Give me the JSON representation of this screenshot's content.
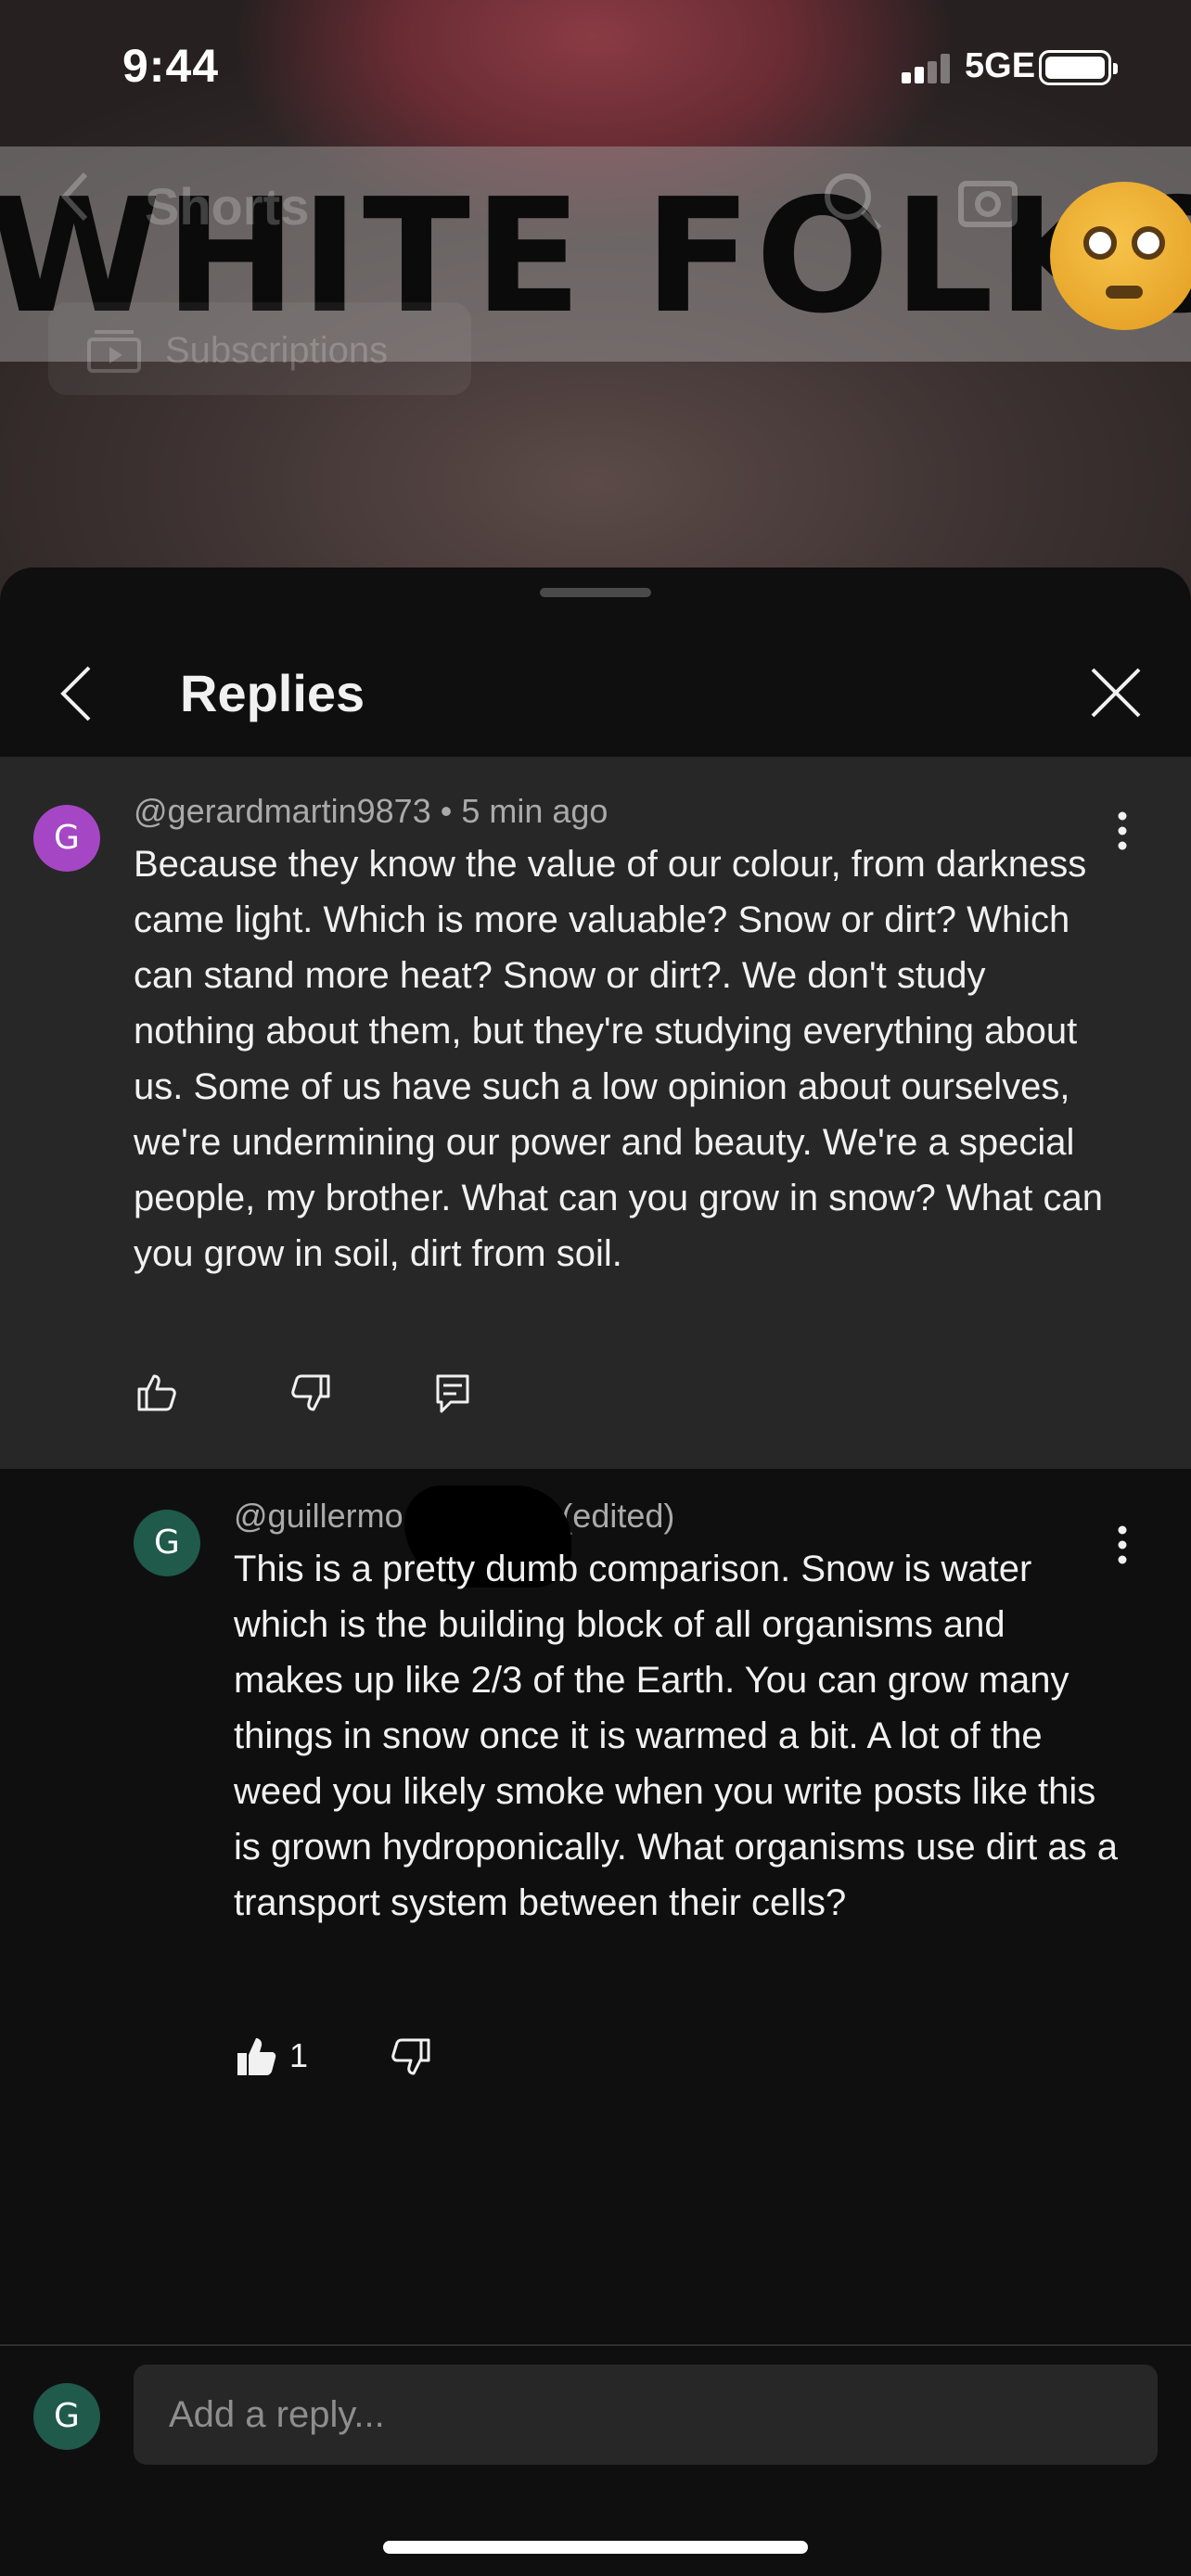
{
  "status_bar": {
    "time": "9:44",
    "network": "5GE"
  },
  "background": {
    "nav_title": "Shorts",
    "subscriptions_label": "Subscriptions",
    "caption": "WHITE FOLKS"
  },
  "sheet": {
    "title": "Replies"
  },
  "parent_comment": {
    "avatar_letter": "G",
    "meta": "@gerardmartin9873 • 5 min ago",
    "text": "Because they know the value of our colour, from darkness came light. Which is more valuable? Snow or dirt? Which can stand more heat? Snow or dirt?. We don't study nothing about them, but they're studying everything about us. Some of us have such a low opinion about ourselves, we're undermining our power and beauty. We're a special people, my brother. What can you grow in snow? What can you grow in soil, dirt from soil."
  },
  "reply_comment": {
    "avatar_letter": "G",
    "meta": "@guillermo                 • 41s ago (edited)",
    "text": "This is a pretty dumb comparison. Snow is water which is the building block of all organisms and makes up like 2/3 of the Earth. You can grow many things in snow once it is warmed a bit. A lot of the weed you likely smoke when you write posts like this is grown hydroponically. What organisms use dirt as a transport system between their cells?",
    "like_count": "1"
  },
  "reply_input": {
    "avatar_letter": "G",
    "placeholder": "Add a reply..."
  },
  "colors": {
    "sheet_bg": "#0f0f0f",
    "highlight_bg": "#272727",
    "avatar_purple": "#a547c4",
    "avatar_green": "#1f5a4b"
  }
}
